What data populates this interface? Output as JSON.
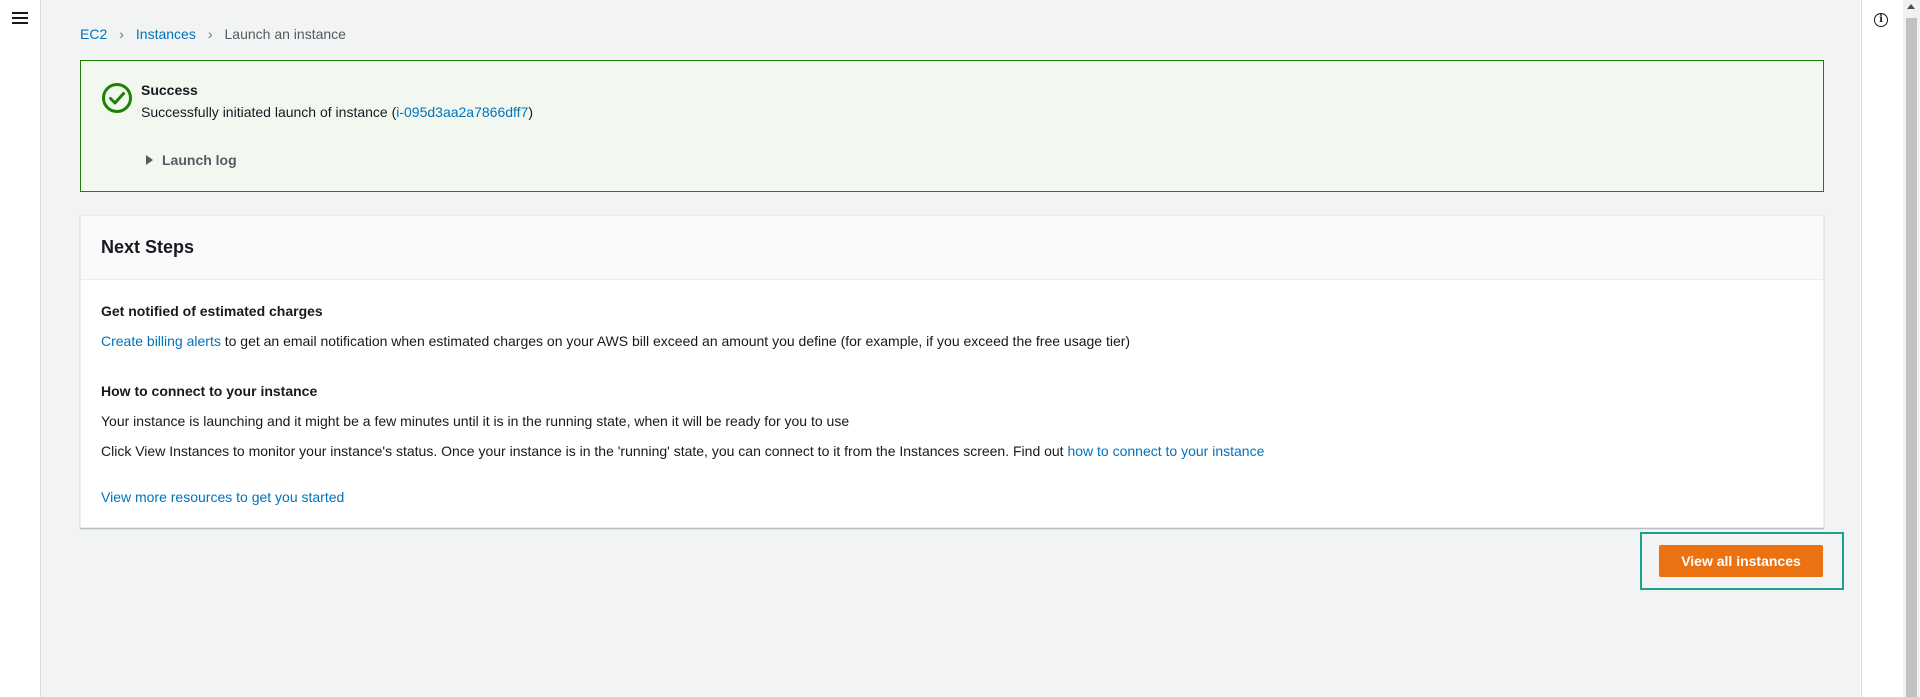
{
  "breadcrumb": {
    "items": [
      {
        "label": "EC2"
      },
      {
        "label": "Instances"
      },
      {
        "label": "Launch an instance"
      }
    ]
  },
  "alert": {
    "title": "Success",
    "message_prefix": "Successfully initiated launch of instance (",
    "instance_id": "i-095d3aa2a7866dff7",
    "message_suffix": ")",
    "launch_log_label": "Launch log",
    "status_color": "#1d8102"
  },
  "next_steps": {
    "title": "Next Steps",
    "billing": {
      "heading": "Get notified of estimated charges",
      "link": "Create billing alerts",
      "text": " to get an email notification when estimated charges on your AWS bill exceed an amount you define (for example, if you exceed the free usage tier)"
    },
    "connect": {
      "heading": "How to connect to your instance",
      "line1": "Your instance is launching and it might be a few minutes until it is in the running state, when it will be ready for you to use",
      "line2_text": "Click View Instances to monitor your instance's status. Once your instance is in the 'running' state, you can connect to it from the Instances screen. Find out ",
      "line2_link": "how to connect to your instance"
    },
    "more_resources_link": "View more resources to get you started"
  },
  "actions": {
    "view_all_label": "View all instances",
    "accent_color": "#ec7211"
  },
  "icons": {
    "menu": "hamburger-menu-icon",
    "info": "info-icon",
    "success": "check-circle-icon"
  },
  "info_glyph": "i"
}
